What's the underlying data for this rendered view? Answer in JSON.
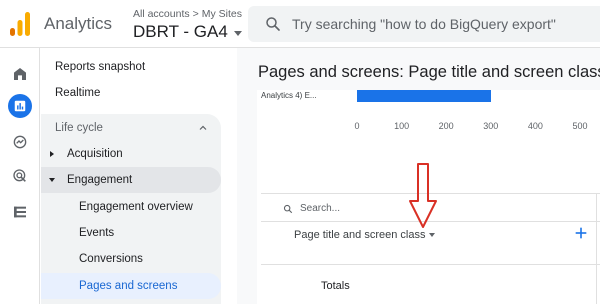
{
  "header": {
    "app_title": "Analytics",
    "breadcrumb_all": "All accounts",
    "breadcrumb_sep": ">",
    "breadcrumb_site": "My Sites",
    "property": "DBRT - GA4",
    "search_placeholder": "Try searching \"how to do BigQuery export\""
  },
  "rail": {
    "icons": [
      "home-icon",
      "reports-icon",
      "explore-icon",
      "advertising-icon",
      "configure-icon"
    ],
    "active": "reports-icon"
  },
  "sidebar": {
    "reports_snapshot": "Reports snapshot",
    "realtime": "Realtime",
    "section_label": "Life cycle",
    "acquisition": "Acquisition",
    "engagement": "Engagement",
    "engagement_overview": "Engagement overview",
    "events": "Events",
    "conversions": "Conversions",
    "pages_and_screens": "Pages and screens"
  },
  "main": {
    "title": "Pages and screens: Page title and screen class",
    "bar_label": "Analytics 4) E...",
    "bar_value": 300,
    "axis_ticks": [
      "0",
      "100",
      "200",
      "300",
      "400",
      "500"
    ],
    "search_placeholder": "Search...",
    "dimension": "Page title and screen class",
    "totals_label": "Totals"
  },
  "colors": {
    "accent": "#1a73e8",
    "annotation_arrow": "#d93025",
    "logo_orange": "#f9ab00",
    "logo_dark": "#e37400"
  }
}
